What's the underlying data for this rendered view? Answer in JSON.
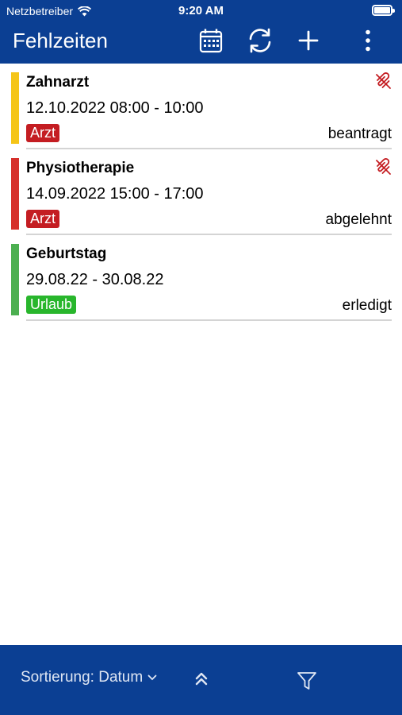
{
  "status_bar": {
    "carrier": "Netzbetreiber",
    "time": "9:20 AM"
  },
  "nav": {
    "title": "Fehlzeiten",
    "icons": [
      "calendar-icon",
      "refresh-icon",
      "add-icon",
      "more-icon"
    ]
  },
  "items": [
    {
      "title": "Zahnarzt",
      "date": "12.10.2022   08:00 - 10:00",
      "tag": "Arzt",
      "status": "beantragt",
      "bar_color": "#f5c518",
      "tag_color": "#c41d22",
      "has_attachment": true
    },
    {
      "title": "Physiotherapie",
      "date": "14.09.2022   15:00 - 17:00",
      "tag": "Arzt",
      "status": "abgelehnt",
      "bar_color": "#d6302b",
      "tag_color": "#c41d22",
      "has_attachment": true
    },
    {
      "title": "Geburtstag",
      "date": "29.08.22 - 30.08.22",
      "tag": "Urlaub",
      "status": "erledigt",
      "bar_color": "#4caf50",
      "tag_color": "#28b62c",
      "has_attachment": false
    }
  ],
  "bottom": {
    "sort_label": "Sortierung: Datum",
    "icons": [
      "chevron-down-icon",
      "double-chevron-up-icon",
      "filter-icon"
    ]
  },
  "colors": {
    "brand": "#0b3f93",
    "attachment": "#c41d22",
    "divider": "#d4d4d4"
  }
}
